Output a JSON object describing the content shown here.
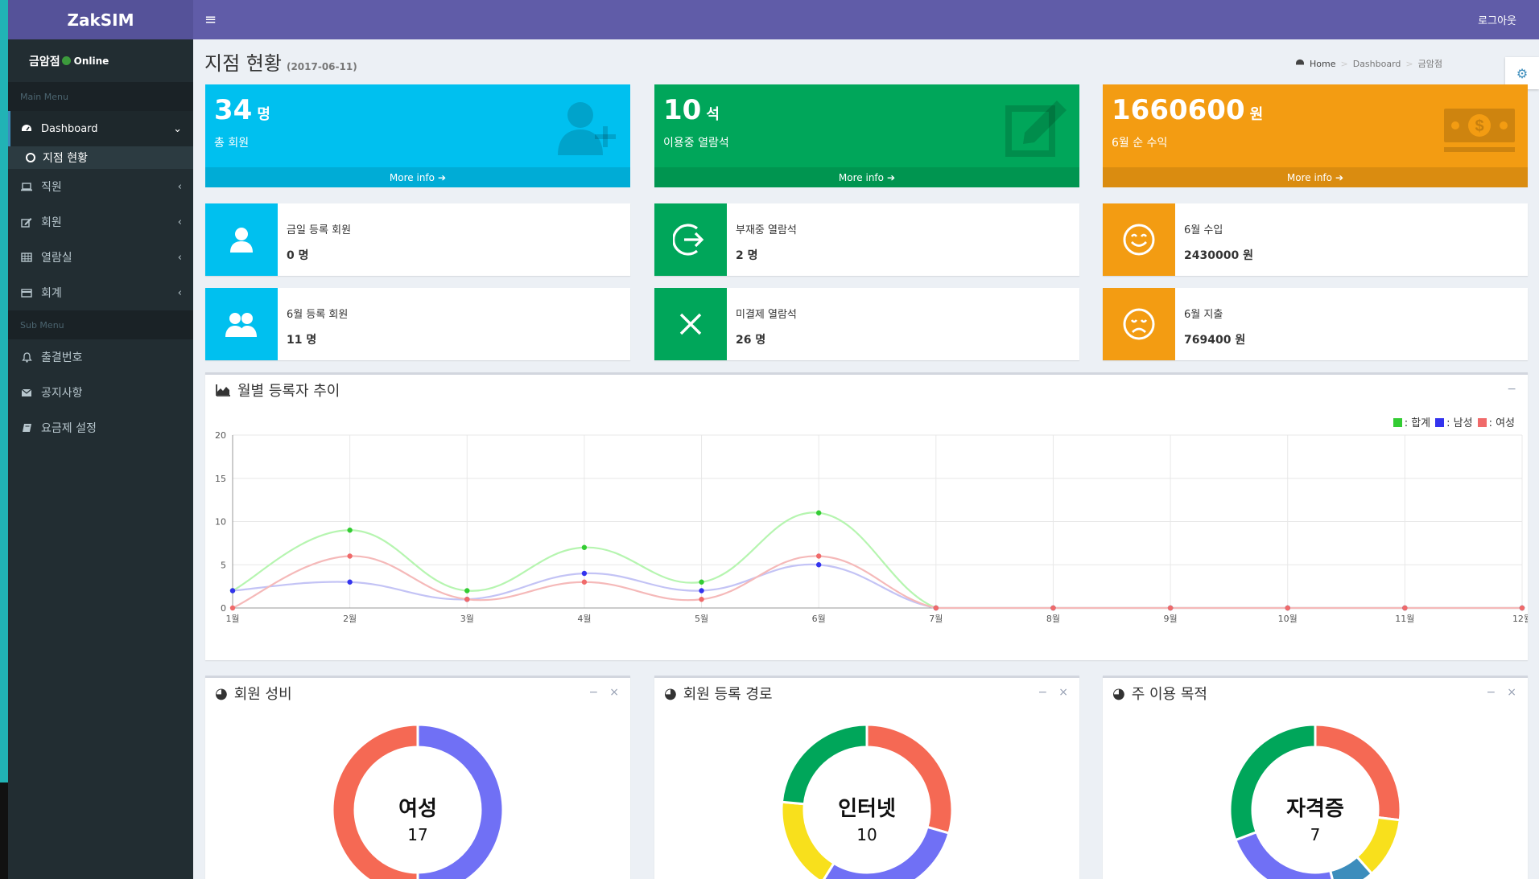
{
  "brand": "ZakSIM",
  "user": {
    "name": "금암점",
    "status": "Online"
  },
  "menu": {
    "main_header": "Main Menu",
    "sub_header": "Sub Menu",
    "dashboard": "Dashboard",
    "dashboard_sub": "지점 현황",
    "items": [
      {
        "label": "직원",
        "icon": "laptop-icon"
      },
      {
        "label": "회원",
        "icon": "edit-icon"
      },
      {
        "label": "열람실",
        "icon": "table-icon"
      },
      {
        "label": "회계",
        "icon": "credit-card-icon"
      }
    ],
    "sub_items": [
      {
        "label": "출결번호",
        "icon": "bell-icon"
      },
      {
        "label": "공지사항",
        "icon": "envelope-icon"
      },
      {
        "label": "요금제 설정",
        "icon": "book-icon"
      }
    ]
  },
  "topbar": {
    "logout": "로그아웃"
  },
  "page": {
    "title": "지점 현황",
    "date": "(2017-06-11)"
  },
  "breadcrumb": {
    "home": "Home",
    "dashboard": "Dashboard",
    "current": "금암점"
  },
  "big_boxes": [
    {
      "value": "34",
      "unit": "명",
      "label": "총 회원",
      "more": "More info",
      "color": "#00c0ef",
      "icon": "user-plus-icon"
    },
    {
      "value": "10",
      "unit": "석",
      "label": "이용중 열람석",
      "more": "More info",
      "color": "#00a65a",
      "icon": "edit-icon"
    },
    {
      "value": "1660600",
      "unit": "원",
      "label": "6월 순 수익",
      "more": "More info",
      "color": "#f39c12",
      "icon": "money-icon"
    }
  ],
  "info_boxes": [
    {
      "label": "금일 등록 회원",
      "value": "0 명",
      "color": "#00c0ef",
      "icon": "user-icon"
    },
    {
      "label": "부재중 열람석",
      "value": "2 명",
      "color": "#00a65a",
      "icon": "sign-out-icon"
    },
    {
      "label": "6월 수입",
      "value": "2430000 원",
      "color": "#f39c12",
      "icon": "smile-icon"
    },
    {
      "label": "6월 등록 회원",
      "value": "11 명",
      "color": "#00c0ef",
      "icon": "users-icon"
    },
    {
      "label": "미결제 열람석",
      "value": "26 명",
      "color": "#00a65a",
      "icon": "times-icon"
    },
    {
      "label": "6월 지출",
      "value": "769400 원",
      "color": "#f39c12",
      "icon": "frown-icon"
    }
  ],
  "line_panel": {
    "title": "월별 등록자 추이",
    "collapse": "−"
  },
  "donut_panels": [
    {
      "title": "회원 성비",
      "collapse": "−",
      "close": "×"
    },
    {
      "title": "회원 등록 경로",
      "collapse": "−",
      "close": "×"
    },
    {
      "title": "주 이용 목적",
      "collapse": "−",
      "close": "×"
    }
  ],
  "chart_data": [
    {
      "type": "line",
      "title": "월별 등록자 추이",
      "categories": [
        "1월",
        "2월",
        "3월",
        "4월",
        "5월",
        "6월",
        "7월",
        "8월",
        "9월",
        "10월",
        "11월",
        "12월"
      ],
      "ylim": [
        0,
        20
      ],
      "yticks": [
        0,
        5,
        10,
        15,
        20
      ],
      "grid": true,
      "legend_position": "top-right",
      "series": [
        {
          "name": ": 합계",
          "color": "#33cc33",
          "line_color": "#b6f5b0",
          "values": [
            2,
            9,
            2,
            7,
            3,
            11,
            0,
            0,
            0,
            0,
            0,
            0
          ]
        },
        {
          "name": ": 남성",
          "color": "#3333ee",
          "line_color": "#c3c3f5",
          "values": [
            2,
            3,
            1,
            4,
            2,
            5,
            0,
            0,
            0,
            0,
            0,
            0
          ]
        },
        {
          "name": ": 여성",
          "color": "#f06a6a",
          "line_color": "#f5b9b9",
          "values": [
            0,
            6,
            1,
            3,
            1,
            6,
            0,
            0,
            0,
            0,
            0,
            0
          ]
        }
      ]
    },
    {
      "type": "pie",
      "title": "회원 성비",
      "center_label": "여성",
      "center_value": "17",
      "slices": [
        {
          "value": 17,
          "color": "#7070f5"
        },
        {
          "value": 17,
          "color": "#f56954"
        }
      ]
    },
    {
      "type": "pie",
      "title": "회원 등록 경로",
      "center_label": "인터넷",
      "center_value": "10",
      "slices": [
        {
          "value": 10,
          "color": "#f56954"
        },
        {
          "value": 10,
          "color": "#7070f5"
        },
        {
          "value": 6,
          "color": "#f8e01c"
        },
        {
          "value": 8,
          "color": "#00a65a"
        }
      ]
    },
    {
      "type": "pie",
      "title": "주 이용 목적",
      "center_label": "자격증",
      "center_value": "7",
      "slices": [
        {
          "value": 7,
          "color": "#f56954"
        },
        {
          "value": 3,
          "color": "#f8e01c"
        },
        {
          "value": 2,
          "color": "#3c8dbc"
        },
        {
          "value": 6,
          "color": "#7070f5"
        },
        {
          "value": 8,
          "color": "#00a65a"
        }
      ]
    }
  ]
}
